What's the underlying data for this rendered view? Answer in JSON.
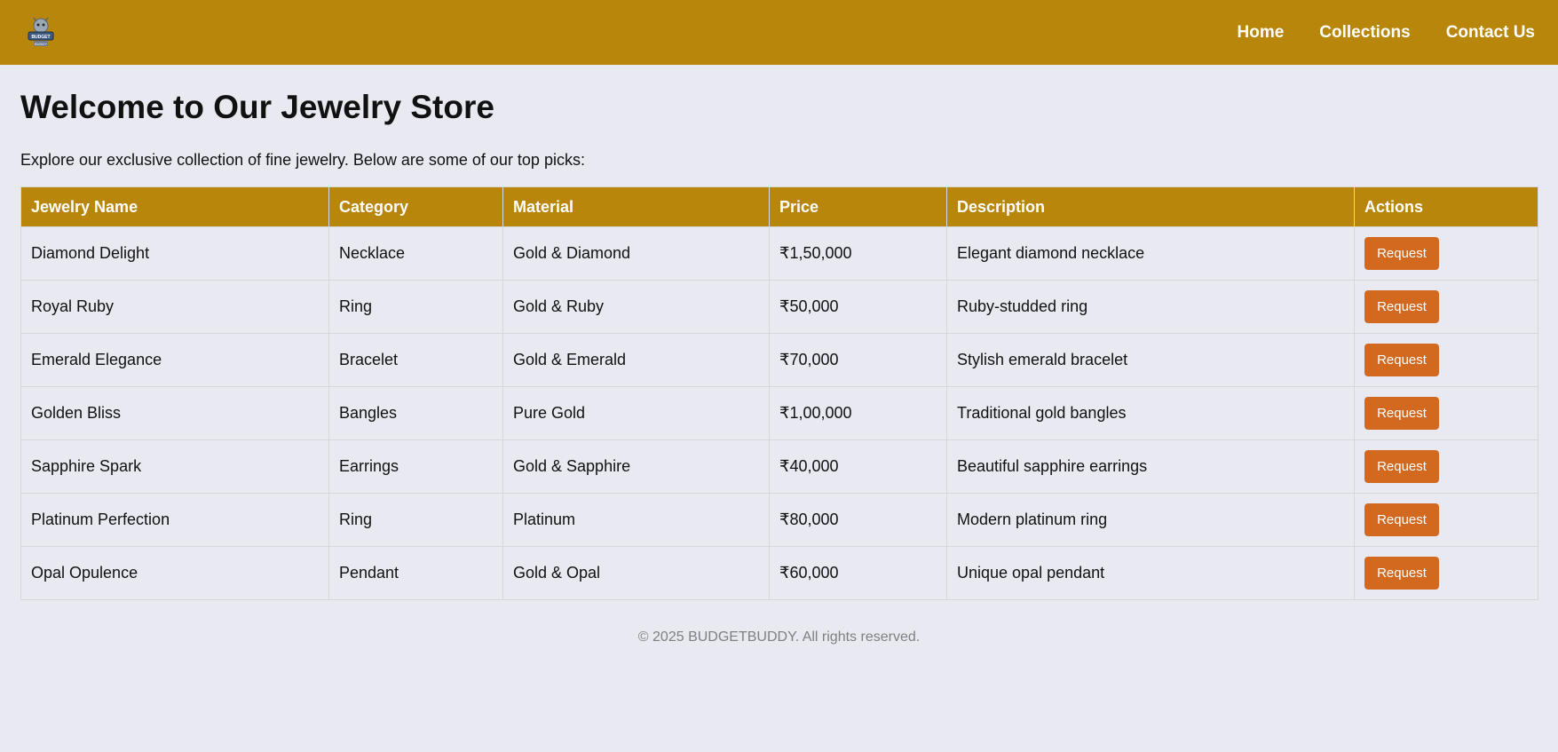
{
  "brand": {
    "logo_text": "BUDGET BUDDY",
    "icon": "budget-buddy-logo-icon"
  },
  "nav": {
    "links": [
      {
        "label": "Home"
      },
      {
        "label": "Collections"
      },
      {
        "label": "Contact Us"
      }
    ]
  },
  "page": {
    "title": "Welcome to Our Jewelry Store",
    "intro": "Explore our exclusive collection of fine jewelry. Below are some of our top picks:"
  },
  "table": {
    "headers": [
      "Jewelry Name",
      "Category",
      "Material",
      "Price",
      "Description",
      "Actions"
    ],
    "rows": [
      {
        "name": "Diamond Delight",
        "category": "Necklace",
        "material": "Gold & Diamond",
        "price": "₹1,50,000",
        "description": "Elegant diamond necklace",
        "action": "Request"
      },
      {
        "name": "Royal Ruby",
        "category": "Ring",
        "material": "Gold & Ruby",
        "price": "₹50,000",
        "description": "Ruby-studded ring",
        "action": "Request"
      },
      {
        "name": "Emerald Elegance",
        "category": "Bracelet",
        "material": "Gold & Emerald",
        "price": "₹70,000",
        "description": "Stylish emerald bracelet",
        "action": "Request"
      },
      {
        "name": "Golden Bliss",
        "category": "Bangles",
        "material": "Pure Gold",
        "price": "₹1,00,000",
        "description": "Traditional gold bangles",
        "action": "Request"
      },
      {
        "name": "Sapphire Spark",
        "category": "Earrings",
        "material": "Gold & Sapphire",
        "price": "₹40,000",
        "description": "Beautiful sapphire earrings",
        "action": "Request"
      },
      {
        "name": "Platinum Perfection",
        "category": "Ring",
        "material": "Platinum",
        "price": "₹80,000",
        "description": "Modern platinum ring",
        "action": "Request"
      },
      {
        "name": "Opal Opulence",
        "category": "Pendant",
        "material": "Gold & Opal",
        "price": "₹60,000",
        "description": "Unique opal pendant",
        "action": "Request"
      }
    ]
  },
  "footer": {
    "text": "© 2025 BUDGETBUDDY. All rights reserved."
  },
  "colors": {
    "navbar": "#b8860b",
    "table_header": "#b8860b",
    "button": "#d2691e",
    "background": "#e8e9f1",
    "footer_text": "#808080"
  }
}
